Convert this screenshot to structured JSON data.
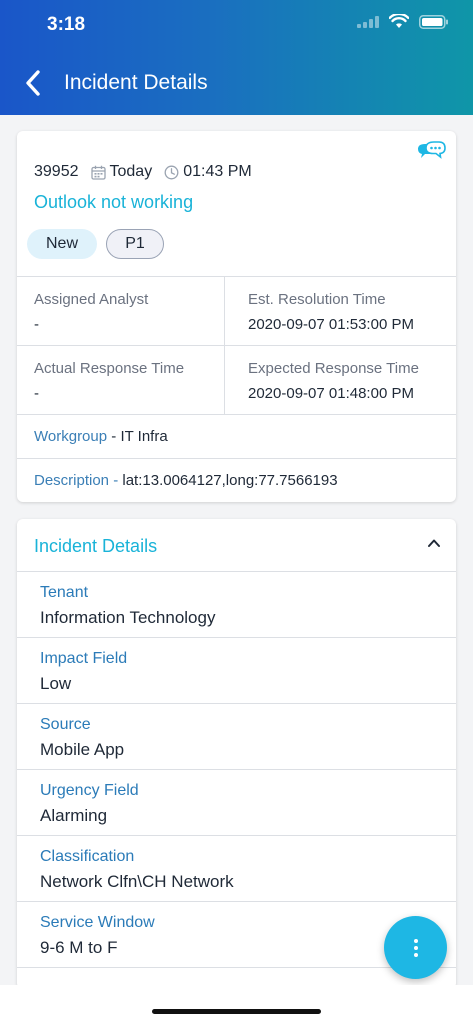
{
  "status_bar": {
    "time": "3:18"
  },
  "header": {
    "title": "Incident Details"
  },
  "summary": {
    "id": "39952",
    "date": "Today",
    "time": "01:43 PM",
    "title": "Outlook not working",
    "status_tag": "New",
    "priority_tag": "P1",
    "assigned_analyst_label": "Assigned Analyst",
    "assigned_analyst_value": "-",
    "est_resolution_label": "Est. Resolution Time",
    "est_resolution_value": "2020-09-07 01:53:00 PM",
    "actual_response_label": "Actual Response Time",
    "actual_response_value": "-",
    "expected_response_label": "Expected Response Time",
    "expected_response_value": "2020-09-07 01:48:00 PM",
    "workgroup_label": "Workgroup",
    "workgroup_sep": " - ",
    "workgroup_value": "IT Infra",
    "description_label": "Description",
    "description_sep": " - ",
    "description_value": "lat:13.0064127,long:77.7566193"
  },
  "details": {
    "section_title": "Incident Details",
    "fields": [
      {
        "label": "Tenant",
        "value": "Information Technology"
      },
      {
        "label": "Impact Field",
        "value": "Low"
      },
      {
        "label": "Source",
        "value": "Mobile App"
      },
      {
        "label": "Urgency Field",
        "value": "Alarming"
      },
      {
        "label": "Classification",
        "value": "Network Clfn\\CH Network"
      },
      {
        "label": "Service Window",
        "value": "9-6 M to F"
      }
    ]
  },
  "colors": {
    "accent": "#19b3d8",
    "label_blue": "#2b7bb8",
    "header_start": "#1a56c9",
    "header_end": "#0f96a8"
  }
}
